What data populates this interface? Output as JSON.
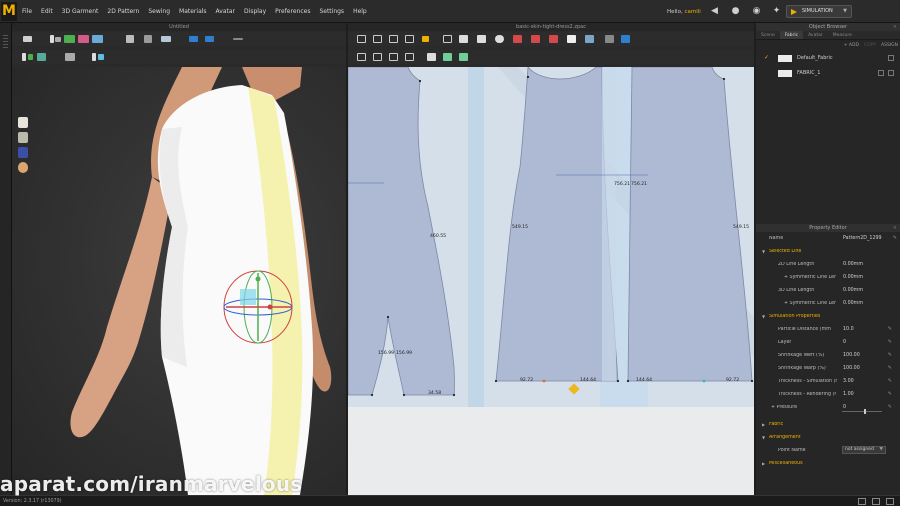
{
  "app": {
    "logo_letter": "M",
    "menu": [
      "File",
      "Edit",
      "3D Garment",
      "2D Pattern",
      "Sewing",
      "Materials",
      "Avatar",
      "Display",
      "Preferences",
      "Settings",
      "Help"
    ],
    "greeting": "Hello,",
    "username": "camili",
    "simulation_label": "SIMULATION",
    "accent_color": "#f0b000"
  },
  "pane3d": {
    "title": "Untitled"
  },
  "pane2d": {
    "title": "basic-skin-tight-dress2.zpac",
    "measurements": [
      "460.55",
      "549.15",
      "756.21",
      "756.21",
      "549.15",
      "156.99",
      "156.99",
      "34.58",
      "92.72",
      "144.64",
      "144.64",
      "92.72"
    ]
  },
  "object_browser": {
    "title": "Object Browser",
    "tabs": [
      "Scene",
      "Fabric",
      "Avatar",
      "Measure"
    ],
    "active_tab": "Fabric",
    "actions": [
      "+ ADD",
      "COPY",
      "ASSIGN"
    ],
    "fabrics": [
      {
        "name": "Default_Fabric",
        "checked": true
      },
      {
        "name": "FABRIC_1",
        "checked": false
      }
    ]
  },
  "property_editor": {
    "title": "Property Editor",
    "name_label": "Name",
    "name_value": "Pattern2D_1299",
    "selected_line": "Selected Line",
    "line_2d_label": "2D Line Length",
    "line_2d_value": "0.00mm",
    "sym_2d_label": "+ Symmetric Line Ler",
    "sym_2d_value": "0.00mm",
    "line_3d_label": "3D Line Length",
    "line_3d_value": "0.00mm",
    "sym_3d_label": "+ Symmetric Line Ler",
    "sym_3d_value": "0.00mm",
    "sim_props": "Simulation Properties",
    "particle_label": "Particle Distance (mm",
    "particle_value": "10.0",
    "layer_label": "Layer",
    "layer_value": "0",
    "weft_label": "Shrinkage Weft (%)",
    "weft_value": "100.00",
    "warp_label": "Shrinkage Warp (%)",
    "warp_value": "100.00",
    "thick_sim_label": "Thickness - Simulation (r",
    "thick_sim_value": "3.00",
    "thick_render_label": "Thickness - Rendering (r",
    "thick_render_value": "1.00",
    "pressure_label": "+ Pressure",
    "pressure_value": "0",
    "fabric": "Fabric",
    "arrangement": "Arrangement",
    "point_name_label": "Point Name",
    "point_name_value": "not assigned",
    "misc": "Miscellaneous"
  },
  "status": {
    "version": "Version: 2.3.17    (r13079)"
  },
  "watermark": "aparat.com/iranmarvelous"
}
